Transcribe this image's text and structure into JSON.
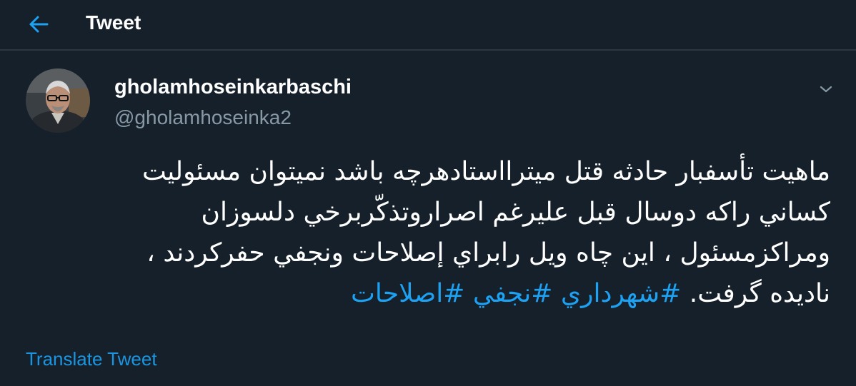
{
  "header": {
    "title": "Tweet",
    "back_icon": "arrow-left-icon",
    "accent_color": "#1da1f2"
  },
  "tweet": {
    "author": {
      "display_name": "gholamhoseinkarbaschi",
      "handle": "@gholamhoseinka2",
      "avatar_icon": "user-photo-avatar"
    },
    "menu_icon": "chevron-down-icon",
    "lines": [
      "ماهيت تأسفبار حادثه قتل ميترااستادهرچه باشد نميتوان مسئوليت",
      "كساني راكه دوسال قبل عليرغم اصراروتذكّربرخي دلسوزان",
      "ومراكزمسئول ، اين چاه ويل رابراي إصلاحات ونجفي حفركردند ،",
      "ناديده گرفت."
    ],
    "hashtags": [
      "#شهرداري",
      "#نجفي",
      "#اصلاحات"
    ],
    "translate_label": "Translate Tweet"
  },
  "colors": {
    "background": "#15202b",
    "text": "#ffffff",
    "secondary_text": "#8899a6",
    "link": "#1da1f2",
    "divider": "#2b3640"
  }
}
